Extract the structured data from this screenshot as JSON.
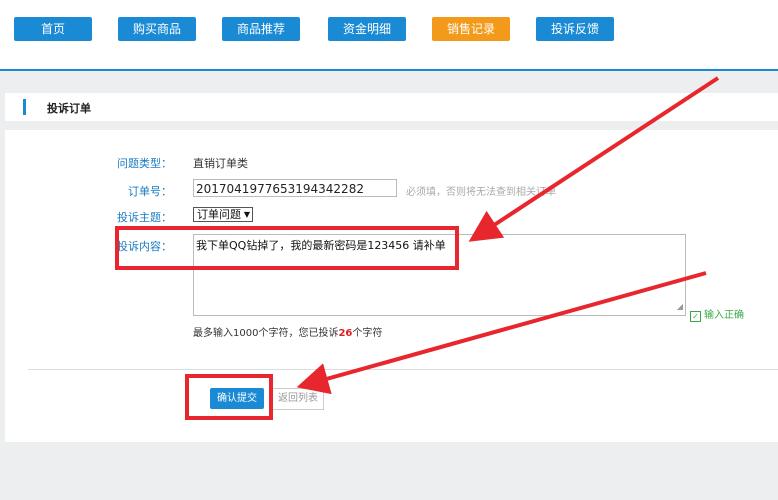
{
  "nav": {
    "items": [
      {
        "label": "首页"
      },
      {
        "label": "购买商品"
      },
      {
        "label": "商品推荐"
      },
      {
        "label": "资金明细"
      },
      {
        "label": "销售记录",
        "active": true
      },
      {
        "label": "投诉反馈"
      }
    ]
  },
  "section": {
    "title": "投诉订单"
  },
  "form": {
    "type_label": "问题类型：",
    "type_value": "直销订单类",
    "order_label": "订单号：",
    "order_value": "20170419776531943422​82",
    "order_hint": "必须填，否则将无法查到相关订单",
    "topic_label": "投诉主题：",
    "topic_value": "订单问题",
    "content_label": "投诉内容：",
    "content_value": "我下单QQ钻掉了，我的最新密码是123456 请补单",
    "valid_text": "输入正确",
    "count_prefix": "最多输入1000个字符，您已投诉",
    "count_num": "26",
    "count_suffix": "个字符",
    "submit_label": "确认提交",
    "back_label": "返回列表"
  },
  "colors": {
    "accent": "#1a8ad5",
    "active_tab": "#f39a1b",
    "annotation": "#e8262d"
  }
}
